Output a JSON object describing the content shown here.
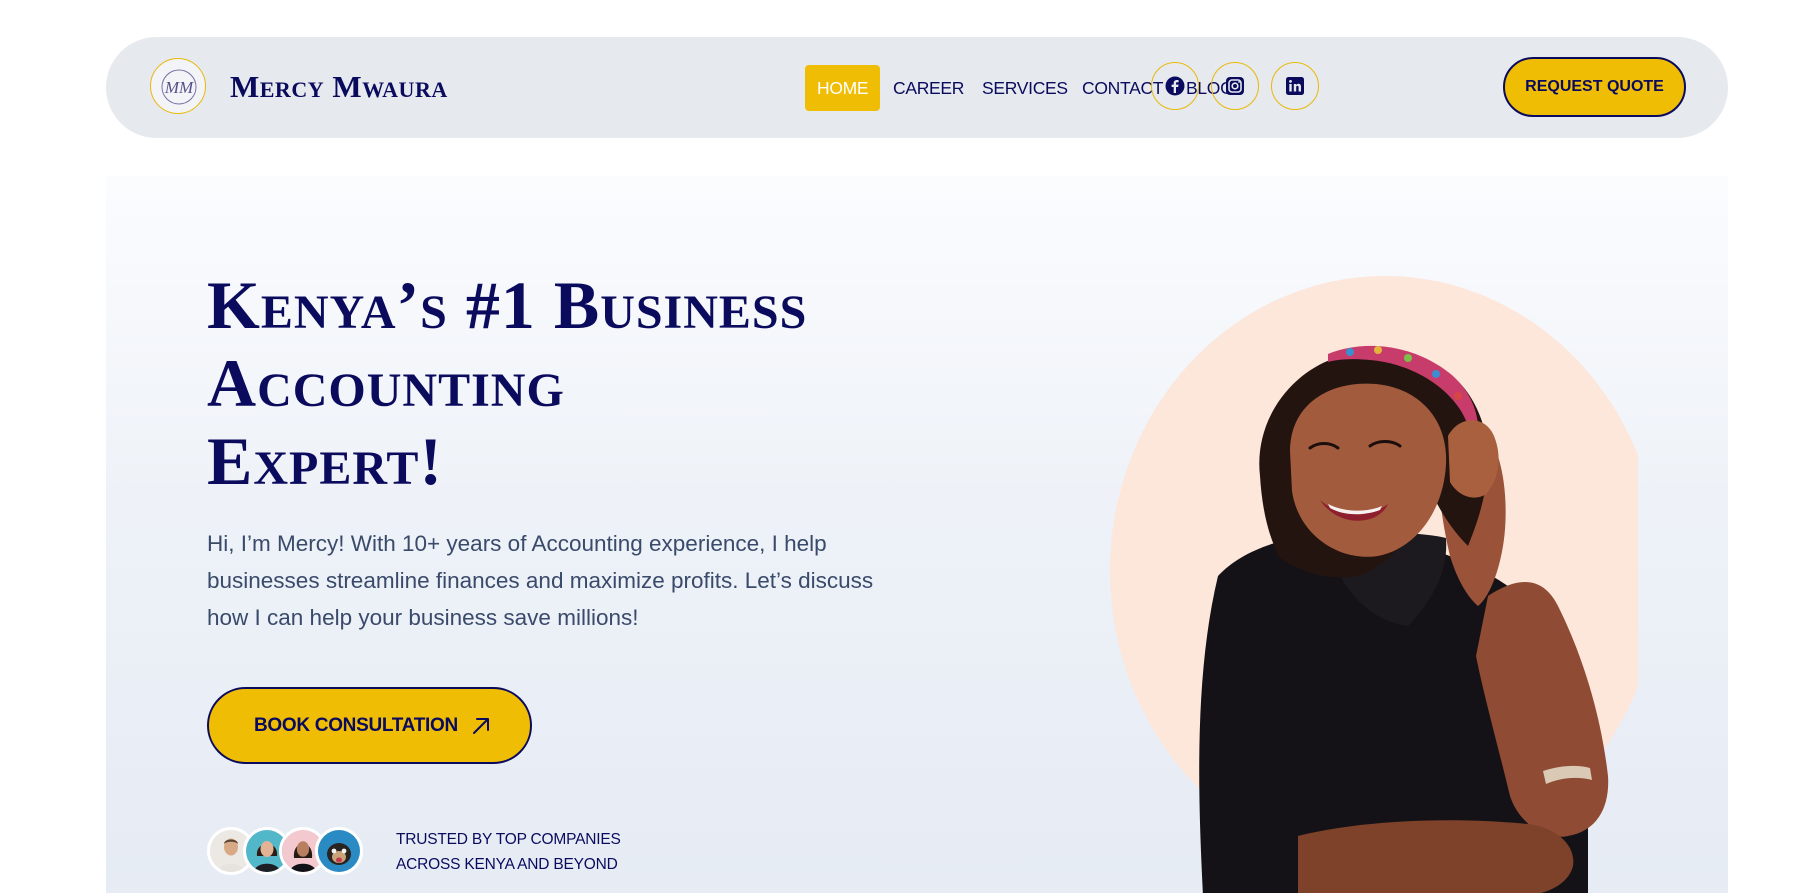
{
  "brand": {
    "name": "Mercy Mwaura",
    "monogram": "MM",
    "colors": {
      "navy": "#0b0b5e",
      "gold": "#f0bd05",
      "peach": "#fde6da"
    }
  },
  "nav": {
    "items": [
      {
        "label": "HOME",
        "active": true
      },
      {
        "label": "CAREER",
        "active": false
      },
      {
        "label": "SERVICES",
        "active": false
      },
      {
        "label": "CONTACT",
        "active": false
      },
      {
        "label": "BLOG",
        "active": false
      }
    ],
    "social": [
      "facebook-icon",
      "instagram-icon",
      "linkedin-icon"
    ],
    "cta_label": "REQUEST QUOTE"
  },
  "hero": {
    "headline": [
      "Kenya’s #1 Business",
      "Accounting",
      "Expert!"
    ],
    "intro": "Hi, I’m Mercy! With 10+ years of Accounting experience, I help businesses streamline finances and maximize profits. Let’s discuss how I can help your business save millions!",
    "cta_label": "BOOK CONSULTATION",
    "cta_icon": "arrow-up-right-icon",
    "trusted_lines": [
      "TRUSTED BY TOP COMPANIES",
      "ACROSS KENYA AND BEYOND"
    ]
  }
}
